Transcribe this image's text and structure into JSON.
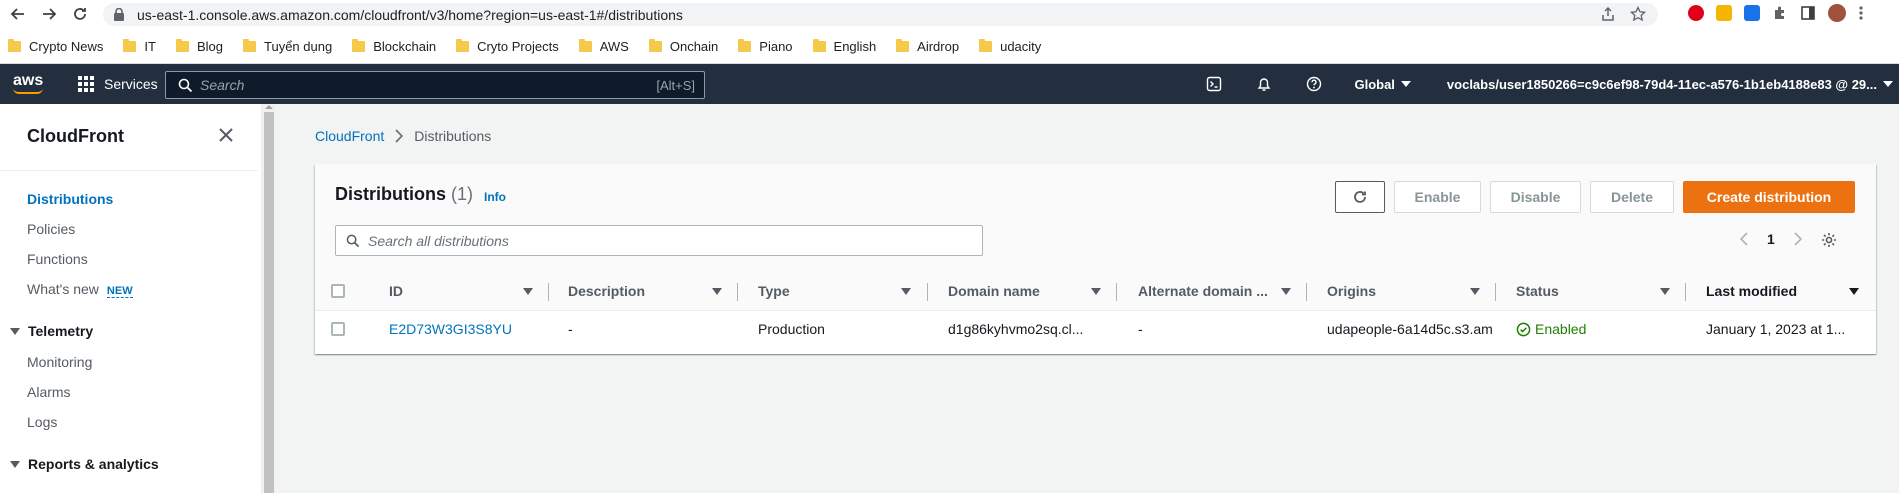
{
  "browser": {
    "url": "us-east-1.console.aws.amazon.com/cloudfront/v3/home?region=us-east-1#/distributions",
    "bookmarks": [
      "Crypto News",
      "IT",
      "Blog",
      "Tuyển dụng",
      "Blockchain",
      "Cryto Projects",
      "AWS",
      "Onchain",
      "Piano",
      "English",
      "Airdrop",
      "udacity"
    ]
  },
  "aws_nav": {
    "logo": "aws",
    "services_label": "Services",
    "search_placeholder": "Search",
    "search_shortcut": "[Alt+S]",
    "region": "Global",
    "account": "voclabs/user1850266=c9c6ef98-79d4-11ec-a576-1b1eb4188e83 @ 29..."
  },
  "sidebar": {
    "title": "CloudFront",
    "items": [
      "Distributions",
      "Policies",
      "Functions",
      "What's new"
    ],
    "new_badge": "NEW",
    "sections": [
      {
        "label": "Telemetry",
        "items": [
          "Monitoring",
          "Alarms",
          "Logs"
        ]
      },
      {
        "label": "Reports & analytics"
      }
    ]
  },
  "breadcrumb": {
    "root": "CloudFront",
    "current": "Distributions"
  },
  "panel": {
    "title": "Distributions",
    "count": "(1)",
    "info": "Info",
    "buttons": {
      "enable": "Enable",
      "disable": "Disable",
      "delete": "Delete",
      "create": "Create distribution"
    },
    "search_placeholder": "Search all distributions",
    "page": "1"
  },
  "table": {
    "columns": [
      "ID",
      "Description",
      "Type",
      "Domain name",
      "Alternate domain ...",
      "Origins",
      "Status",
      "Last modified"
    ],
    "rows": [
      {
        "id": "E2D73W3GI3S8YU",
        "description": "-",
        "type": "Production",
        "domain": "d1g86kyhvmo2sq.cl...",
        "alternate": "-",
        "origins": "udapeople-6a14d5c.s3.am",
        "status": "Enabled",
        "modified": "January 1, 2023 at 1..."
      }
    ]
  },
  "colors": {
    "accent": "#ec7211",
    "link": "#0073bb",
    "nav_bg": "#232f3e",
    "success": "#1d8102"
  }
}
